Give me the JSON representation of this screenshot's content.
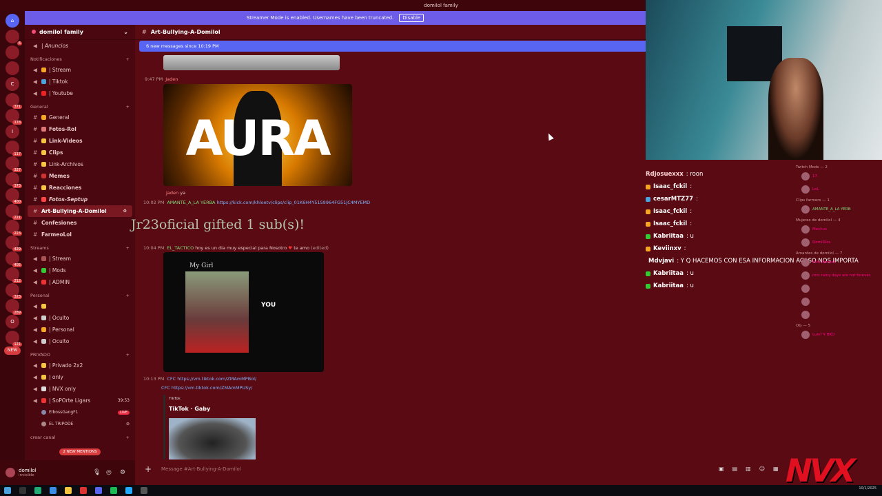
{
  "topbar": {
    "title": "domilol family"
  },
  "banner": {
    "text": "Streamer Mode is enabled. Usernames have been truncated.",
    "button": "Disable"
  },
  "rail": {
    "servers": [
      "C",
      "Ⅰ",
      "O"
    ],
    "badges": [
      "6",
      "371",
      "178",
      "117",
      "327",
      "373",
      "400",
      "221",
      "223",
      "429",
      "405",
      "212",
      "323",
      "289",
      "121"
    ],
    "new_label": "NEW"
  },
  "sidebar": {
    "server_name": "domilol family",
    "anuncios": "| Anuncios",
    "categories": [
      {
        "name": "Notificaciones",
        "channels": [
          "| Stream",
          "| Tiktok",
          "| Youtube"
        ]
      },
      {
        "name": "General",
        "channels": [
          "General",
          "Fotos-Rol",
          "Link-Videos",
          "Clips",
          "Link-Archivos",
          "Memes",
          "Reacciones",
          "Fotos-Septup",
          "Art-Bullying-A-Domilol",
          "Confesiones",
          "FarmeoLol"
        ]
      },
      {
        "name": "Streams",
        "channels": [
          "| Stream",
          "| Mods",
          "| ADMIN"
        ]
      },
      {
        "name": "Personal",
        "channels": [
          "",
          "| Oculto",
          "| Personal",
          "| Oculto"
        ]
      },
      {
        "name": "PRIVADO",
        "channels": [
          "| Privado 2x2",
          "| only",
          "| NVX only",
          "| SoPOrte Ligars"
        ]
      }
    ],
    "voice_users": [
      "ElbossGangF1",
      "EL TRIPODE"
    ],
    "voice_time": "39:53",
    "live": "LIVE",
    "crear": "crear canal",
    "mentions": "2 NEW MENTIONS"
  },
  "user": {
    "name": "domilol",
    "status": "invisible"
  },
  "channel": {
    "name": "Art-Bullying-A-Domilol",
    "new_messages": "6 new messages since 10:19 PM",
    "input_placeholder": "Message #Art-Bullying-A-Domilol"
  },
  "messages": {
    "m1_time": "9:47 PM",
    "m1_user": "Jaden",
    "aura_text": "AURA",
    "m2_user": "Jaden",
    "m2_text": "ya",
    "m3_time": "10:02 PM",
    "m3_user": "AMANTE_A_LA YERBA",
    "m3_link": "https://kick.com/khloetv/clips/clip_01K6H4Y51S9964FG51JC4MYEMD",
    "gifted": "Jr23oficial gifted 1 sub(s)!",
    "m4_time": "10:04 PM",
    "m4_user": "EL_TACTICO",
    "m4_text": "hoy es un dia muy especial para Nosotro",
    "m4_tail": "te amo",
    "m4_edited": "(edited)",
    "card_title": "My Girl",
    "card_you": "YOU",
    "m5_time": "10:13 PM",
    "m5_user": "CFC",
    "m5_link1": "https://vm.tiktok.com/ZMAmMPBol/",
    "m6_user": "CFC",
    "m6_link2": "https://vm.tiktok.com/ZMAmMPUSy/",
    "tt_site": "TikTok",
    "tt_title": "TikTok · Gaby"
  },
  "chat": [
    {
      "user": "Rdjosuexxx",
      "msg": ": roon",
      "color": "#f3b1b1"
    },
    {
      "user": "Isaac_fckil",
      "msg": ":",
      "color": "#f2f2f2"
    },
    {
      "user": "cesarMTZ77",
      "msg": ":",
      "color": "#f2f2f2"
    },
    {
      "user": "Isaac_fckil",
      "msg": ":",
      "color": "#f2f2f2"
    },
    {
      "user": "Isaac_fckil",
      "msg": ":",
      "color": "#f2f2f2"
    },
    {
      "user": "Kabriitaa",
      "msg": ": u",
      "color": "#f2f2f2"
    },
    {
      "user": "Keviinxv",
      "msg": ":",
      "color": "#f2f2f2"
    },
    {
      "user": "Mdvjavi",
      "msg": ": Y Q HACEMOS CON ESA INFORMACION ACASO NOS IMPORTA",
      "color": "#f2f2f2"
    },
    {
      "user": "Kabriitaa",
      "msg": ": u",
      "color": "#f2f2f2"
    },
    {
      "user": "Kabriitaa",
      "msg": ": u",
      "color": "#f2f2f2"
    }
  ],
  "members": {
    "sections": [
      "Twitch Mods — 2",
      "Clips farmers — 1",
      "Mujeres de domilol — 4",
      "Amantes de domilol — 7",
      "OG — 5"
    ],
    "names": [
      "17.",
      "LoL",
      "AMANTE_A_LA YERB",
      "Mechus",
      "DomiDios",
      "Kick Partner",
      "mm rainy days are not forever.",
      "Luis? ¥ BKO"
    ]
  },
  "overlay": {
    "logo": "NVX"
  },
  "taskbar": {
    "time": "",
    "date": "10/1/2025"
  },
  "colors": {
    "bg": "#5a0a12",
    "blurple": "#5865f2",
    "mention": "#d83c3e"
  }
}
